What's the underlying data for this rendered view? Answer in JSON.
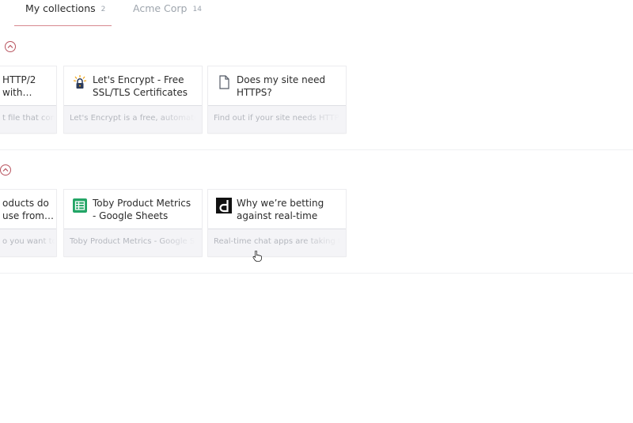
{
  "tabs": [
    {
      "label": "My collections",
      "count": "2",
      "active": true
    },
    {
      "label": "Acme Corp",
      "count": "14",
      "active": false
    }
  ],
  "collections": [
    {
      "cards": [
        {
          "title": "HTTP/2 with…",
          "desc": "t file that con",
          "icon": "none"
        },
        {
          "title": "Let's Encrypt - Free SSL/TLS Certificates",
          "desc": "Let's Encrypt is a free, automated",
          "icon": "letsencrypt-icon"
        },
        {
          "title": "Does my site need HTTPS?",
          "desc": "Find out if your site needs HTTPS",
          "icon": "document-icon"
        }
      ]
    },
    {
      "cards": [
        {
          "title": "oducts do use from…",
          "desc": "o you want to",
          "icon": "none"
        },
        {
          "title": "Toby Product Metrics - Google Sheets",
          "desc": "Toby Product Metrics - Google She",
          "icon": "google-sheets-icon"
        },
        {
          "title": "Why we’re betting against real-time tea…",
          "desc": "Real-time chat apps are taking the",
          "icon": "d-logo-icon"
        }
      ]
    }
  ],
  "colors": {
    "accent": "#b8545f",
    "tab_indicator": "#d7888f",
    "sheets_green": "#23a566"
  }
}
